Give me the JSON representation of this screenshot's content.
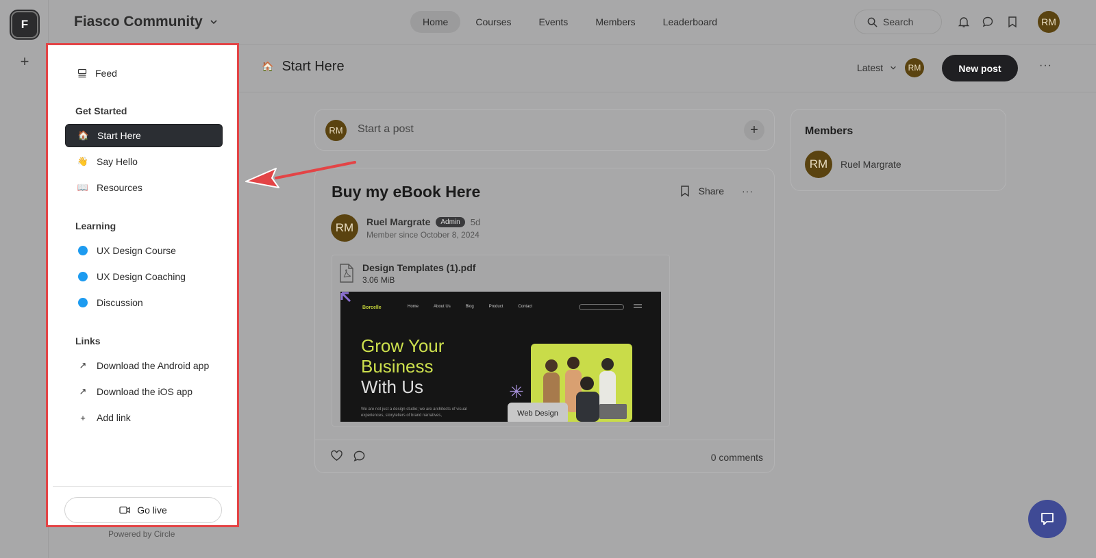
{
  "rail": {
    "logo_letter": "F",
    "add_label": "+"
  },
  "topbar": {
    "community_name": "Fiasco Community",
    "nav": [
      "Home",
      "Courses",
      "Events",
      "Members",
      "Leaderboard"
    ],
    "active_nav": "Home",
    "search_label": "Search",
    "user_initials": "RM"
  },
  "space": {
    "emoji": "🏠",
    "title": "Start Here",
    "sort_label": "Latest",
    "avatar_initials": "RM",
    "new_post_label": "New post",
    "more": "···"
  },
  "composer": {
    "avatar_initials": "RM",
    "placeholder": "Start a post",
    "plus": "+"
  },
  "post": {
    "title": "Buy my eBook Here",
    "share_label": "Share",
    "more": "···",
    "author": "Ruel Margrate",
    "author_initials": "RM",
    "role_badge": "Admin",
    "age": "5d",
    "member_since": "Member since October 8, 2024",
    "attachment": {
      "file_name": "Design Templates (1).pdf",
      "file_size": "3.06 MiB",
      "preview": {
        "brand": "Borcelle",
        "nav": [
          "Home",
          "About Us",
          "Blog",
          "Product",
          "Contact"
        ],
        "headline_line1": "Grow Your",
        "headline_line2": "Business",
        "headline_line3": "With Us",
        "body": "We are not just a design studio; we are architects of visual experiences, storytellers of brand narratives,",
        "tag": "Web Design"
      }
    },
    "comments_label": "0 comments"
  },
  "members_widget": {
    "title": "Members",
    "member_name": "Ruel Margrate",
    "member_initials": "RM"
  },
  "sidebar": {
    "feed_label": "Feed",
    "groups": [
      {
        "heading": "Get Started",
        "items": [
          {
            "label": "Start Here",
            "emoji": "🏠",
            "active": true
          },
          {
            "label": "Say Hello",
            "emoji": "👋"
          },
          {
            "label": "Resources",
            "emoji": "📖"
          }
        ]
      },
      {
        "heading": "Learning",
        "items": [
          {
            "label": "UX Design Course"
          },
          {
            "label": "UX Design Coaching"
          },
          {
            "label": "Discussion"
          }
        ]
      },
      {
        "heading": "Links",
        "items": [
          {
            "label": "Download the Android app",
            "icon": "↗"
          },
          {
            "label": "Download the iOS app",
            "icon": "↗"
          },
          {
            "label": "Add link",
            "icon": "+"
          }
        ]
      }
    ],
    "go_live_label": "Go live",
    "powered_by": "Powered by Circle"
  },
  "colors": {
    "highlight_border": "#e34446",
    "arrow": "#e34446",
    "channel_dot": "#1d9bf0",
    "chat_button": "#3f4a95"
  }
}
